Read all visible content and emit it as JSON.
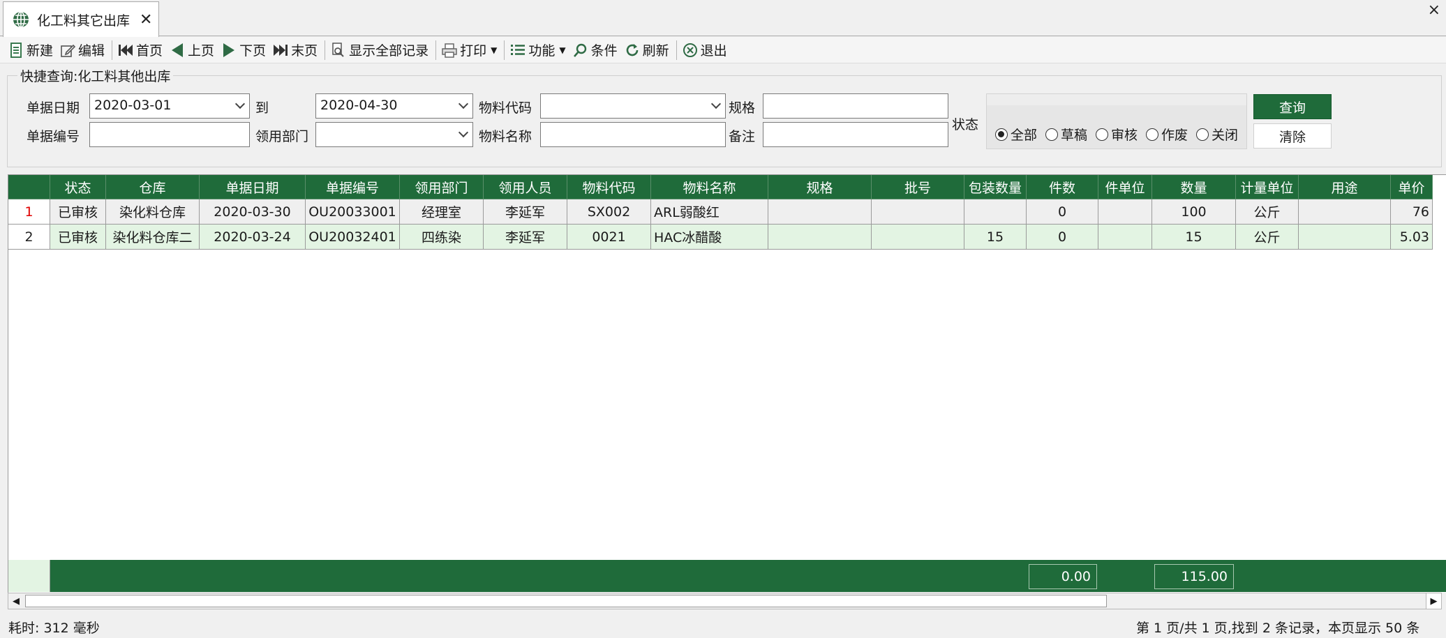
{
  "tab": {
    "title": "化工料其它出库",
    "close": "✕"
  },
  "window_close": "×",
  "toolbar": {
    "new": "新建",
    "edit": "编辑",
    "first": "首页",
    "prev": "上页",
    "next": "下页",
    "last": "末页",
    "show_all": "显示全部记录",
    "print": "打印",
    "function": "功能",
    "condition": "条件",
    "refresh": "刷新",
    "exit": "退出"
  },
  "query": {
    "group_title": "快捷查询:化工料其他出库",
    "date_label": "单据日期",
    "date_from": "2020-03-01",
    "to_label": "到",
    "date_to": "2020-04-30",
    "material_code_label": "物料代码",
    "material_code": "",
    "spec_label": "规格",
    "spec": "",
    "doc_no_label": "单据编号",
    "doc_no": "",
    "dept_label": "领用部门",
    "dept": "",
    "material_name_label": "物料名称",
    "material_name": "",
    "remark_label": "备注",
    "remark": "",
    "status_label": "状态",
    "status_options": [
      "全部",
      "草稿",
      "审核",
      "作废",
      "关闭"
    ],
    "status_selected": "全部",
    "query_button": "查询",
    "clear_button": "清除"
  },
  "grid": {
    "columns": [
      "状态",
      "仓库",
      "单据日期",
      "单据编号",
      "领用部门",
      "领用人员",
      "物料代码",
      "物料名称",
      "规格",
      "批号",
      "包装数量",
      "件数",
      "件单位",
      "数量",
      "计量单位",
      "用途",
      "单价"
    ],
    "rows": [
      {
        "n": "1",
        "status": "已审核",
        "warehouse": "染化料仓库",
        "date": "2020-03-30",
        "doc_no": "OU20033001",
        "dept": "经理室",
        "person": "李延军",
        "code": "SX002",
        "name": "ARL弱酸红",
        "spec": "",
        "batch": "",
        "pack_qty": "",
        "pieces": "0",
        "piece_unit": "",
        "qty": "100",
        "unit": "公斤",
        "usage": "",
        "price": "76"
      },
      {
        "n": "2",
        "status": "已审核",
        "warehouse": "染化料仓库二",
        "date": "2020-03-24",
        "doc_no": "OU20032401",
        "dept": "四练染",
        "person": "李延军",
        "code": "0021",
        "name": "HAC冰醋酸",
        "spec": "",
        "batch": "",
        "pack_qty": "15",
        "pieces": "0",
        "piece_unit": "",
        "qty": "15",
        "unit": "公斤",
        "usage": "",
        "price": "5.03"
      }
    ],
    "footer": {
      "pieces_total": "0.00",
      "qty_total": "115.00"
    }
  },
  "statusbar": {
    "elapsed": "耗时: 312 毫秒",
    "paging": "第 1 页/共 1 页,找到 2 条记录，本页显示 50 条"
  },
  "colors": {
    "accent": "#1f6b3a",
    "row_alt": "#e3f4e3",
    "row_num_first": "#e00000"
  }
}
